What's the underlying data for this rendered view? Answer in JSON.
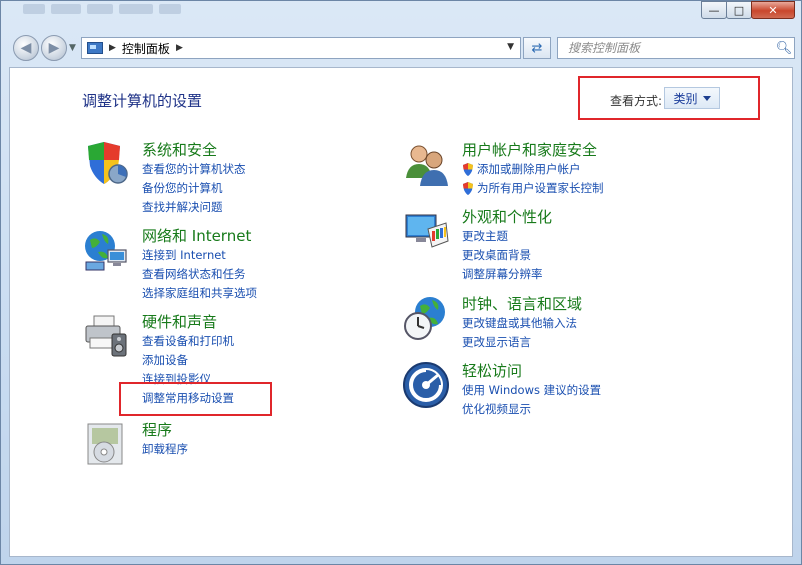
{
  "address": {
    "crumb": "控制面板"
  },
  "search": {
    "placeholder": "搜索控制面板"
  },
  "page_title": "调整计算机的设置",
  "view_by": {
    "label": "查看方式:",
    "value": "类别"
  },
  "left_categories": [
    {
      "title": "系统和安全",
      "links": [
        "查看您的计算机状态",
        "备份您的计算机",
        "查找并解决问题"
      ]
    },
    {
      "title": "网络和 Internet",
      "links": [
        "连接到 Internet",
        "查看网络状态和任务",
        "选择家庭组和共享选项"
      ]
    },
    {
      "title": "硬件和声音",
      "links": [
        "查看设备和打印机",
        "添加设备",
        "连接到投影仪",
        "调整常用移动设置"
      ]
    },
    {
      "title": "程序",
      "links": [
        "卸载程序"
      ]
    }
  ],
  "right_categories": [
    {
      "title": "用户帐户和家庭安全",
      "links": [
        "添加或删除用户帐户",
        "为所有用户设置家长控制"
      ]
    },
    {
      "title": "外观和个性化",
      "links": [
        "更改主题",
        "更改桌面背景",
        "调整屏幕分辨率"
      ]
    },
    {
      "title": "时钟、语言和区域",
      "links": [
        "更改键盘或其他输入法",
        "更改显示语言"
      ]
    },
    {
      "title": "轻松访问",
      "links": [
        "使用 Windows 建议的设置",
        "优化视频显示"
      ]
    }
  ],
  "colors": {
    "category_title": "#177a1a",
    "link": "#1a4fb0",
    "highlight": "#e0262b",
    "page_title": "#1e3287"
  }
}
